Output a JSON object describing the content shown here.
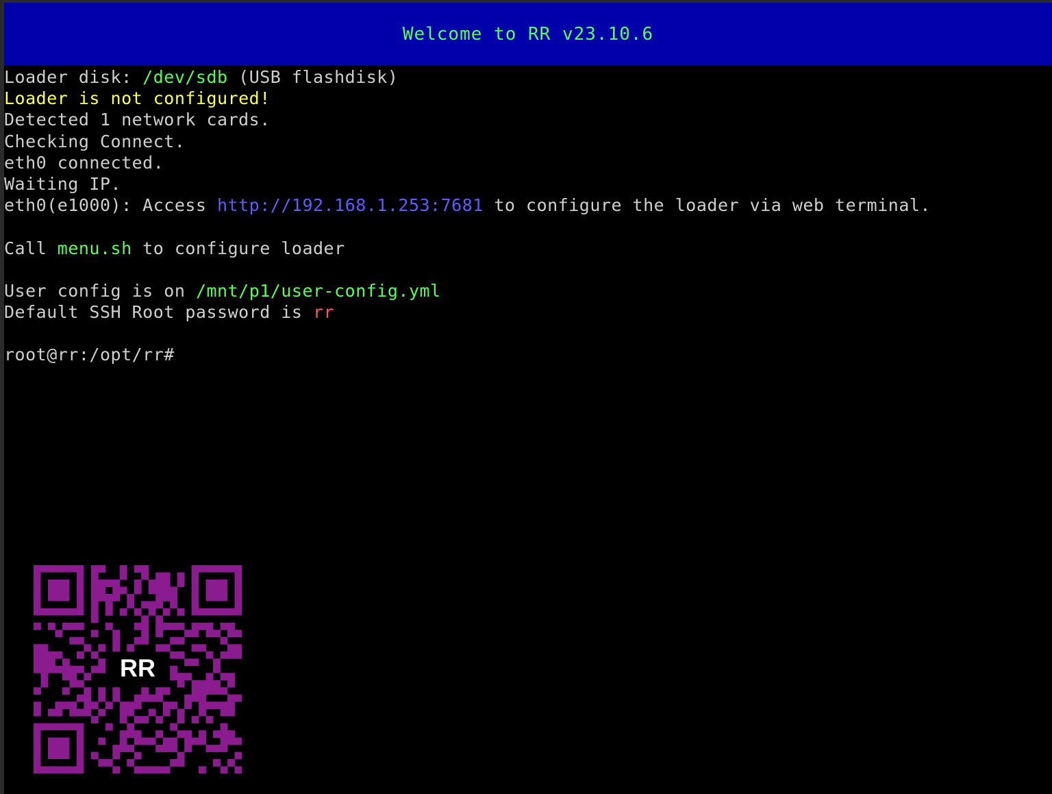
{
  "header": {
    "title": "Welcome to RR v23.10.6"
  },
  "lines": [
    [
      {
        "text": "Loader disk: ",
        "color": "default"
      },
      {
        "text": "/dev/sdb",
        "color": "green"
      },
      {
        "text": " (USB flashdisk)",
        "color": "default"
      }
    ],
    [
      {
        "text": "Loader is not configured!",
        "color": "yellow"
      }
    ],
    [
      {
        "text": "Detected 1 network cards.",
        "color": "default"
      }
    ],
    [
      {
        "text": "Checking Connect.",
        "color": "default"
      }
    ],
    [
      {
        "text": "eth0 connected.",
        "color": "default"
      }
    ],
    [
      {
        "text": "Waiting IP.",
        "color": "default"
      }
    ],
    [
      {
        "text": "eth0(e1000): Access ",
        "color": "default"
      },
      {
        "text": "http://192.168.1.253:7681",
        "color": "blue"
      },
      {
        "text": " to configure the loader via web terminal.",
        "color": "default"
      }
    ],
    [],
    [
      {
        "text": "Call ",
        "color": "default"
      },
      {
        "text": "menu.sh",
        "color": "green"
      },
      {
        "text": " to configure loader",
        "color": "default"
      }
    ],
    [],
    [
      {
        "text": "User config is on ",
        "color": "default"
      },
      {
        "text": "/mnt/p1/user-config.yml",
        "color": "green"
      }
    ],
    [
      {
        "text": "Default SSH Root password is ",
        "color": "default"
      },
      {
        "text": "rr",
        "color": "red"
      }
    ],
    [],
    [
      {
        "text": "root@rr:/opt/rr#",
        "color": "default"
      }
    ]
  ],
  "qr": {
    "logo_text": "RR",
    "color": "#8a1c8f"
  },
  "colors": {
    "console_background": "#000000",
    "header_background": "#0000aa",
    "default_text": "#cfcfcf",
    "green": "#55ff55",
    "yellow": "#ffff55",
    "blue": "#5c5cff",
    "red": "#ff5555"
  }
}
